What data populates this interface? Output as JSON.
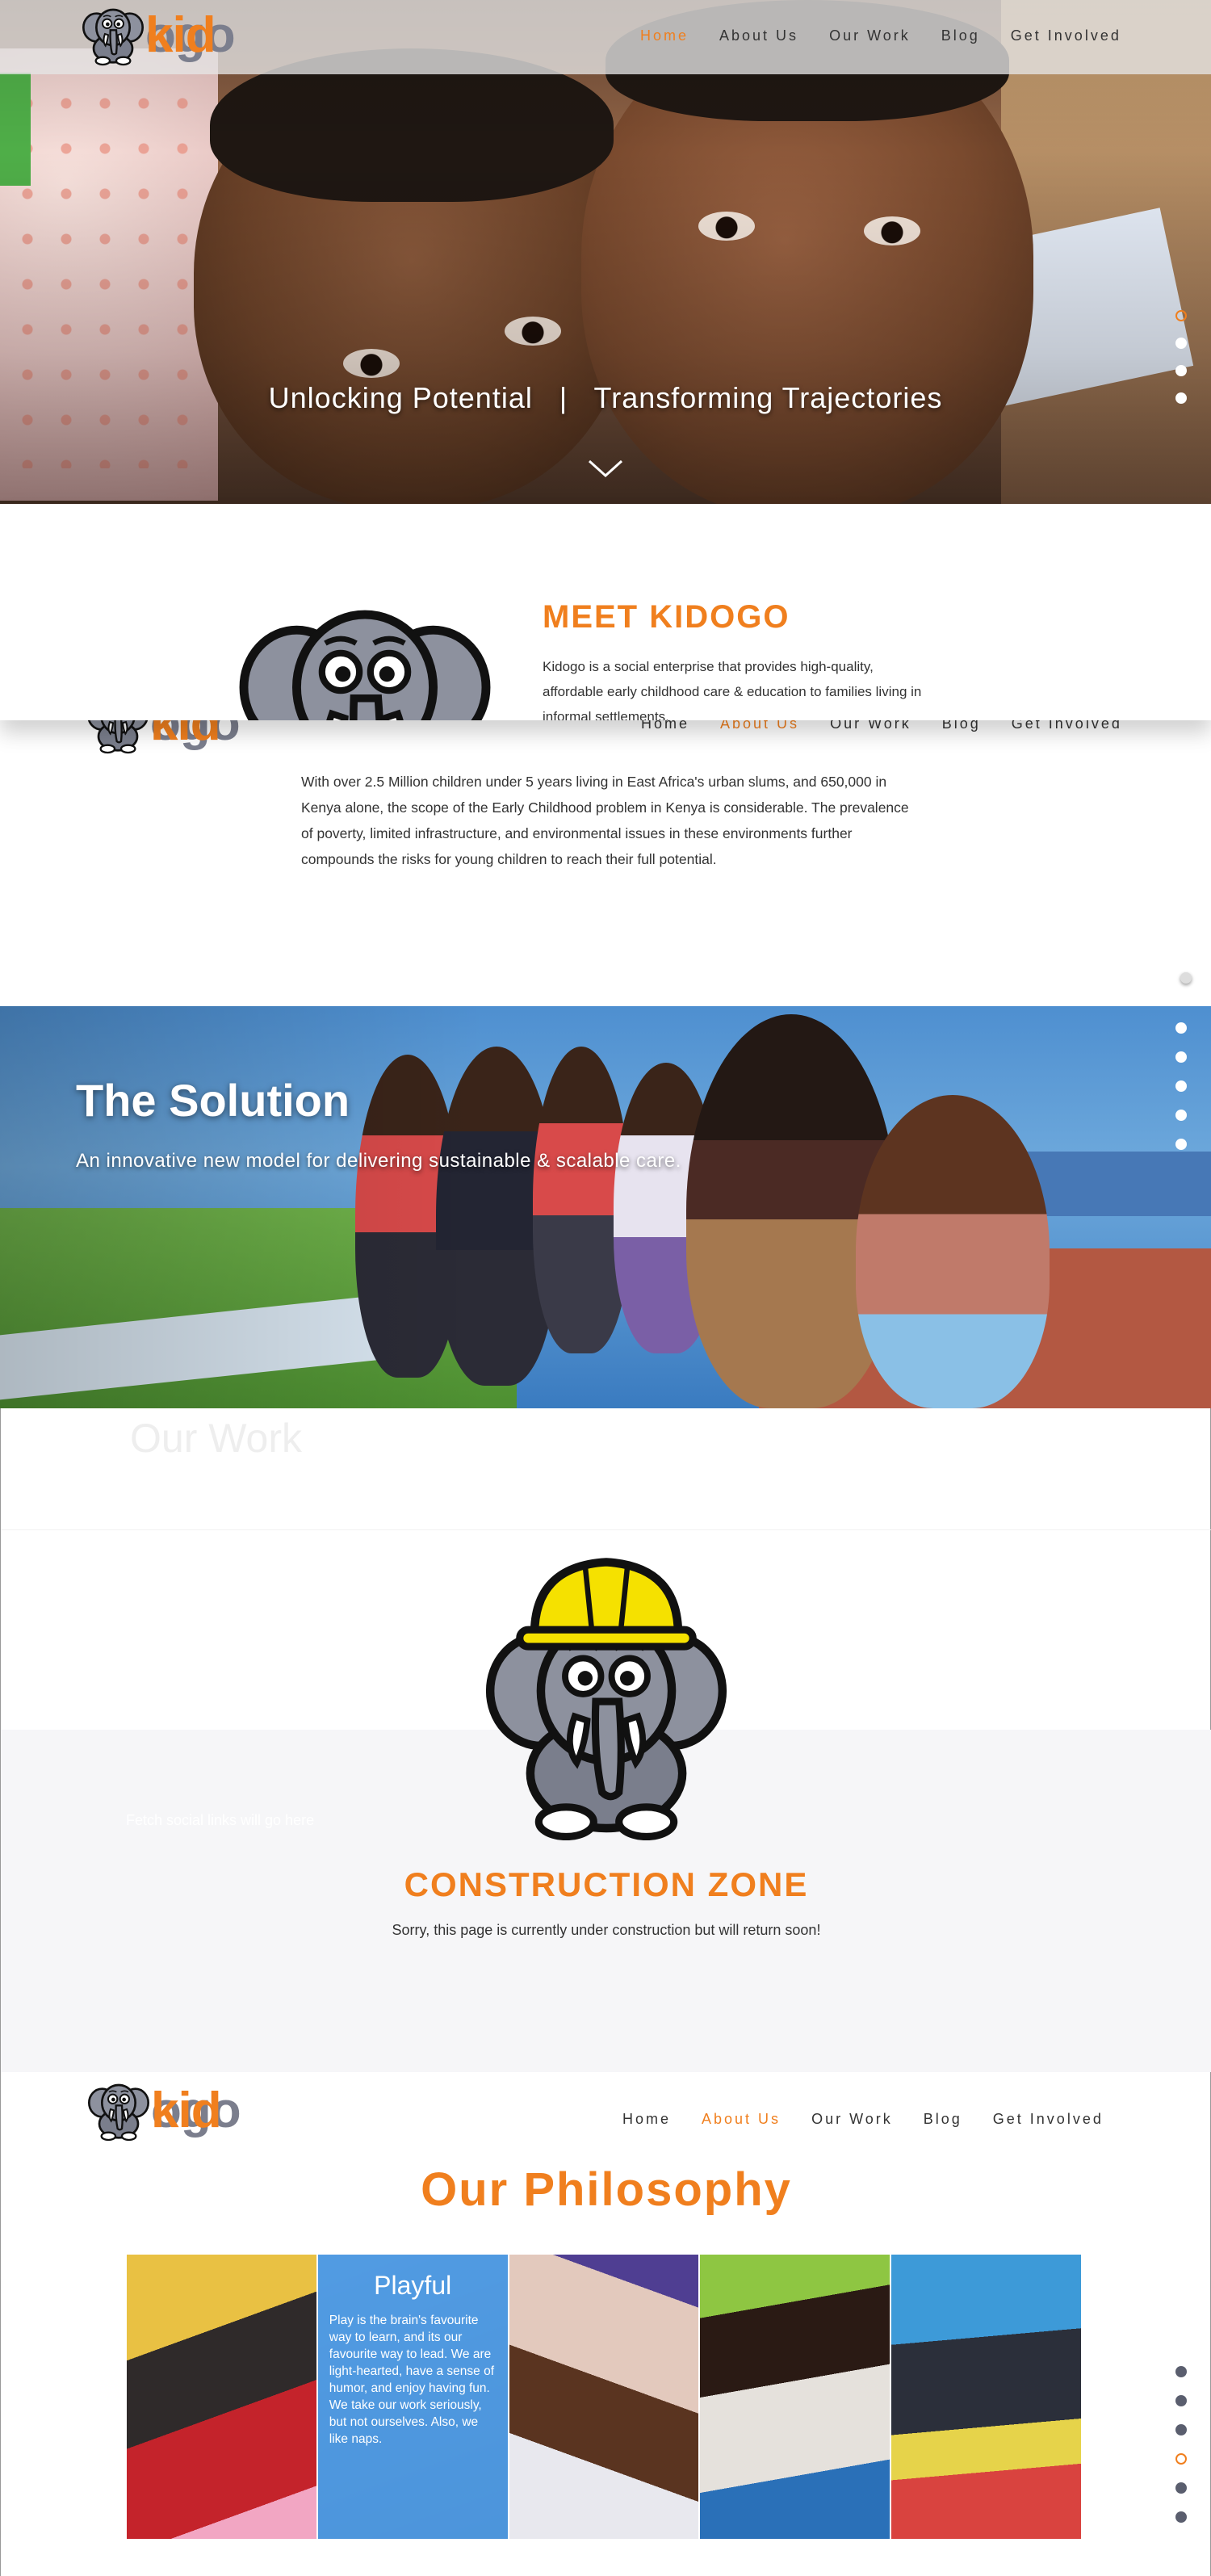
{
  "brand": {
    "kid": "kid",
    "ogo": "ogo"
  },
  "nav": [
    "Home",
    "About Us",
    "Our Work",
    "Blog",
    "Get Involved"
  ],
  "hero": {
    "tagline": "Unlocking Potential   |   Transforming Trajectories",
    "dots_active_index": 0,
    "dot_count": 4
  },
  "meet": {
    "title": "MEET KIDOGO",
    "body": "Kidogo is a social enterprise that provides high-quality, affordable early childhood care & education to families living in informal settlements."
  },
  "about": {
    "body": "With over 2.5 Million children under 5 years living in East Africa's urban slums, and 650,000 in Kenya alone, the scope of the Early Childhood problem in Kenya is considerable. The prevalence of poverty, limited infrastructure, and environmental issues in these environments further compounds the risks for young children to reach their full potential."
  },
  "solution": {
    "title": "The Solution",
    "subtitle": "An innovative new model for delivering sustainable & scalable care.",
    "dot_count": 6
  },
  "construction": {
    "ghost_heading": "Our Work",
    "ghost_caption": "Fetch social links will go here",
    "title": "CONSTRUCTION ZONE",
    "message": "Sorry, this page is currently under construction but will return soon!"
  },
  "philosophy": {
    "title": "Our Philosophy",
    "card": {
      "title": "Playful",
      "body": "Play is the brain's favourite way to learn, and its our favourite way to lead. We are light-hearted, have a sense of humor, and enjoy having fun. We take our work seriously, but not ourselves. Also, we like naps."
    },
    "dot_count": 6,
    "dots_active_index": 3
  },
  "colors": {
    "accent": "#f07f1e",
    "brand_grey": "#7b7e8d",
    "overlay_blue": "#52a1ea"
  }
}
